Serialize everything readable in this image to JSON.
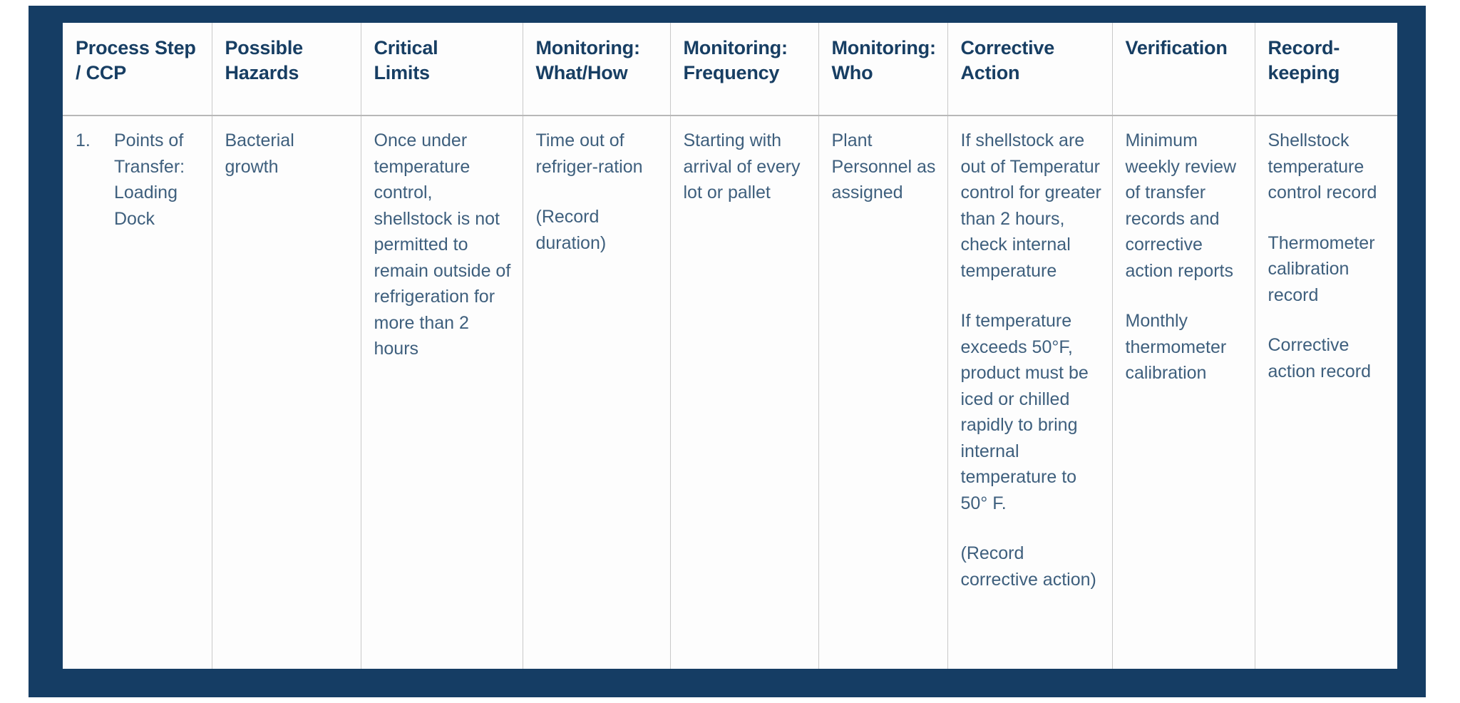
{
  "theme": {
    "panel_color": "#153d64",
    "sheet_color": "#fdfdfd",
    "header_text_color": "#173e63",
    "body_text_color": "#3e5f7d",
    "grid_line_color": "#c9c9c9"
  },
  "table": {
    "headers": [
      "Process Step / CCP",
      "Possible Hazards",
      "Critical Limits",
      "Monitoring: What/How",
      "Monitoring: Frequency",
      "Monitoring: Who",
      "Corrective Action",
      "Verification",
      "Record-keeping"
    ],
    "header_lines": [
      [
        "Process Step",
        "/ CCP"
      ],
      [
        "Possible",
        "Hazards"
      ],
      [
        "Critical",
        "Limits"
      ],
      [
        "Monitoring:",
        "What/How"
      ],
      [
        "Monitoring:",
        "Frequency"
      ],
      [
        "Monitoring:",
        "Who"
      ],
      [
        "Corrective",
        "Action"
      ],
      [
        "Verification"
      ],
      [
        "Record-",
        "keeping"
      ]
    ],
    "rows": [
      {
        "process_step": {
          "marker": "1.",
          "text": "Points of Transfer: Loading Dock"
        },
        "possible_hazards": [
          "Bacterial growth"
        ],
        "critical_limits": [
          "Once under temperature control, shellstock is not permitted to remain outside of refrigeration for more than 2 hours"
        ],
        "monitoring_what_how": [
          "Time out of refriger-ration",
          "(Record duration)"
        ],
        "monitoring_frequency": [
          "Starting with arrival of every lot or pallet"
        ],
        "monitoring_who": [
          "Plant Personnel as assigned"
        ],
        "corrective_action": [
          "If shellstock are out of Temperatur control for greater than 2 hours, check internal temperature",
          "If temperature exceeds 50°F, product must be iced or chilled rapidly to bring internal temperature to 50° F.",
          "(Record corrective action)"
        ],
        "verification": [
          "Minimum weekly review of transfer records and corrective action reports",
          "Monthly thermometer calibration"
        ],
        "record_keeping": [
          "Shellstock temperature control record",
          "Thermometer calibration record",
          "Corrective action record"
        ]
      }
    ]
  }
}
